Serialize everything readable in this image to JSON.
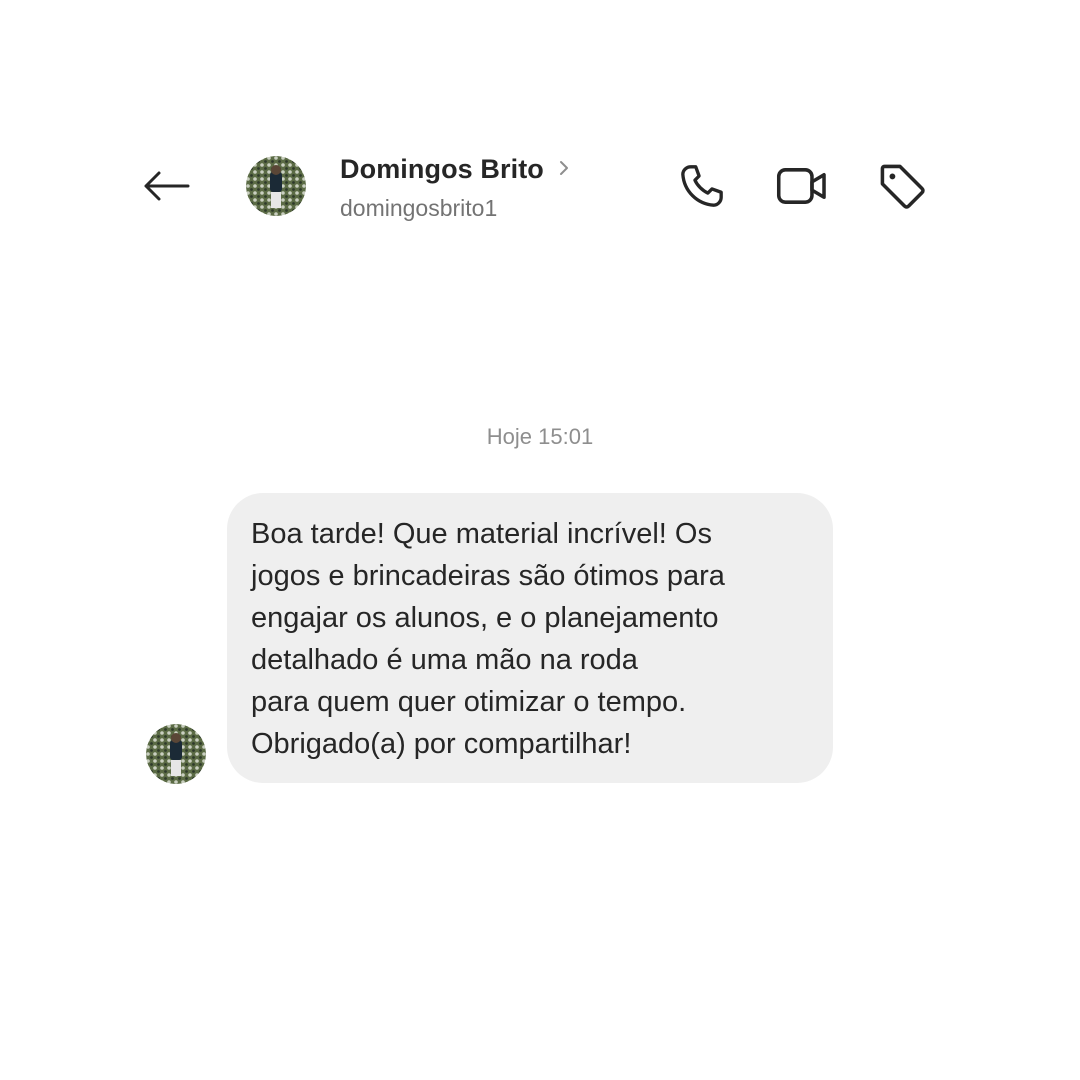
{
  "header": {
    "back_icon": "arrow-left-icon",
    "avatar_icon": "profile-avatar",
    "name": "Domingos Brito",
    "username": "domingosbrito1",
    "chevron_icon": "chevron-right-icon",
    "actions": [
      {
        "icon": "phone-icon"
      },
      {
        "icon": "video-camera-icon"
      },
      {
        "icon": "tag-icon"
      }
    ]
  },
  "conversation": {
    "timestamp": "Hoje 15:01",
    "messages": [
      {
        "sender": "Domingos Brito",
        "lines": [
          "Boa tarde! Que material incrível! Os",
          "jogos e brincadeiras são ótimos para",
          "engajar os alunos, e o planejamento",
          "detalhado é uma mão na roda",
          "para quem quer otimizar o tempo.",
          "Obrigado(a) por compartilhar!"
        ]
      }
    ]
  },
  "colors": {
    "background": "#ffffff",
    "text_primary": "#262626",
    "text_secondary": "#737373",
    "timestamp": "#8e8e8e",
    "bubble": "#efefef"
  }
}
